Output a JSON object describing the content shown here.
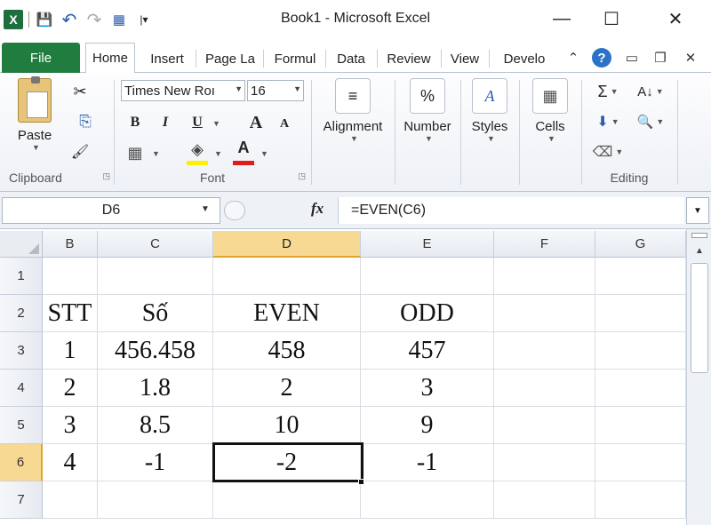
{
  "window": {
    "title": "Book1  -  Microsoft Excel",
    "minimize": "—",
    "maximize": "☐",
    "close": "✕"
  },
  "qat": {
    "logo": "X",
    "save": "💾",
    "undo": "↶",
    "redo": "↷",
    "custom": "▦",
    "more": "|▾"
  },
  "tabs": {
    "file": "File",
    "items": [
      "Home",
      "Insert",
      "Page La",
      "Formul",
      "Data",
      "Review",
      "View",
      "Develo"
    ]
  },
  "right_icons": {
    "collapse": "⌃",
    "help": "?",
    "min": "▭",
    "restore": "❐",
    "close": "✕"
  },
  "ribbon": {
    "clipboard": {
      "label": "Clipboard",
      "paste": "Paste",
      "cut_icon": "✂",
      "copy_icon": "⎘",
      "painter_icon": "🖌"
    },
    "font": {
      "label": "Font",
      "font_name": "Times New Roı",
      "font_size": "16",
      "bold": "B",
      "italic": "I",
      "underline": "U",
      "grow": "A",
      "shrink": "A",
      "border_icon": "▦",
      "fill_icon": "◈",
      "color_icon": "A",
      "fill_color": "#ffef00",
      "text_color": "#e21b1b"
    },
    "alignment": {
      "label": "Alignment",
      "icon": "≡"
    },
    "number": {
      "label": "Number",
      "icon": "%"
    },
    "styles": {
      "label": "Styles",
      "icon": "A"
    },
    "cells": {
      "label": "Cells",
      "icon": "▦"
    },
    "editing": {
      "label": "Editing",
      "sum_icon": "Σ",
      "sort_icon": "A↓",
      "fill_icon": "⬇",
      "find_icon": "🔍",
      "clear_icon": "⌫"
    }
  },
  "formula_bar": {
    "name_box": "D6",
    "fx": "fx",
    "formula": "=EVEN(C6)"
  },
  "grid": {
    "columns": [
      "B",
      "C",
      "D",
      "E",
      "F",
      "G"
    ],
    "selected_column": "D",
    "rows": [
      "1",
      "2",
      "3",
      "4",
      "5",
      "6",
      "7"
    ],
    "selected_row": "6",
    "cells": [
      [
        "",
        "",
        "",
        "",
        "",
        ""
      ],
      [
        "STT",
        "Số",
        "EVEN",
        "ODD",
        "",
        ""
      ],
      [
        "1",
        "456.458",
        "458",
        "457",
        "",
        ""
      ],
      [
        "2",
        "1.8",
        "2",
        "3",
        "",
        ""
      ],
      [
        "3",
        "8.5",
        "10",
        "9",
        "",
        ""
      ],
      [
        "4",
        "-1",
        "-2",
        "-1",
        "",
        ""
      ],
      [
        "",
        "",
        "",
        "",
        "",
        ""
      ]
    ]
  }
}
